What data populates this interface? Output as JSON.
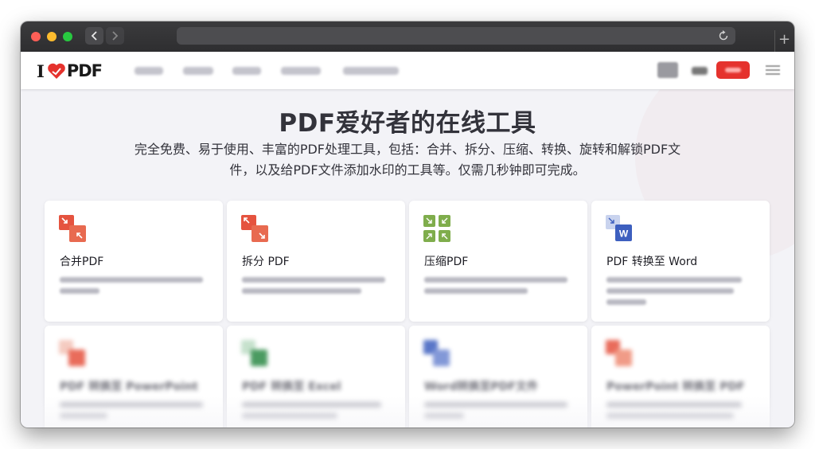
{
  "browser": {
    "new_tab_glyph": "+"
  },
  "site": {
    "logo": {
      "left": "I",
      "right": "PDF"
    },
    "hero": {
      "title": "PDF爱好者的在线工具",
      "subtitle_line1": "完全免费、易于使用、丰富的PDF处理工具，包括：合并、拆分、压缩、转换、旋转和解锁PDF文",
      "subtitle_line2": "件，以及给PDF文件添加水印的工具等。仅需几秒钟即可完成。"
    },
    "tools": [
      {
        "title": "合并PDF",
        "icon": "merge-pdf-icon",
        "color": "#e5533f"
      },
      {
        "title": "拆分 PDF",
        "icon": "split-pdf-icon",
        "color": "#e5533f"
      },
      {
        "title": "压缩PDF",
        "icon": "compress-pdf-icon",
        "color": "#7fad4c"
      },
      {
        "title": "PDF 转换至 Word",
        "icon": "pdf-to-word-icon",
        "color": "#3d5fbf"
      },
      {
        "title": "PDF 转换至 PowerPoint",
        "icon": "pdf-to-powerpoint-icon",
        "color": "#e5533f"
      },
      {
        "title": "PDF 转换至 Excel",
        "icon": "pdf-to-excel-icon",
        "color": "#2c8a46"
      },
      {
        "title": "Word转换至PDF文件",
        "icon": "word-to-pdf-icon",
        "color": "#3d5fbf"
      },
      {
        "title": "PowerPoint 转换至 PDF",
        "icon": "powerpoint-to-pdf-icon",
        "color": "#e5533f"
      }
    ]
  },
  "colors": {
    "brand_red": "#e5322d",
    "page_bg": "#f3f3f7",
    "title_text": "#33333b"
  }
}
